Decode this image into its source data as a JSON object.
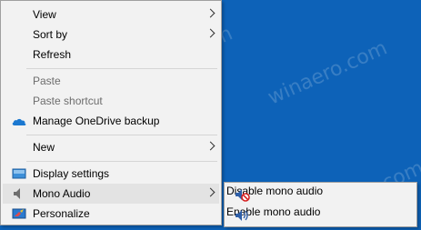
{
  "context_menu": {
    "items": [
      {
        "label": "View",
        "has_submenu": true
      },
      {
        "label": "Sort by",
        "has_submenu": true
      },
      {
        "label": "Refresh"
      },
      {
        "label": "Paste",
        "disabled": true
      },
      {
        "label": "Paste shortcut",
        "disabled": true
      },
      {
        "label": "Manage OneDrive backup",
        "icon": "onedrive-cloud-icon"
      },
      {
        "label": "New",
        "has_submenu": true
      },
      {
        "label": "Display settings",
        "icon": "display-icon"
      },
      {
        "label": "Mono Audio",
        "icon": "speaker-icon",
        "has_submenu": true,
        "highlighted": true
      },
      {
        "label": "Personalize",
        "icon": "personalize-icon"
      }
    ]
  },
  "submenu": {
    "items": [
      {
        "label": "Disable mono audio",
        "icon": "speaker-disabled-icon"
      },
      {
        "label": "Enable mono audio",
        "icon": "speaker-enabled-icon"
      }
    ]
  },
  "watermark": "winaero.com",
  "colors": {
    "desktop": "#0d62b8",
    "menu_bg": "#f2f2f2",
    "hover_bg": "#e3e3e3",
    "disabled_text": "#6d6d6d"
  }
}
